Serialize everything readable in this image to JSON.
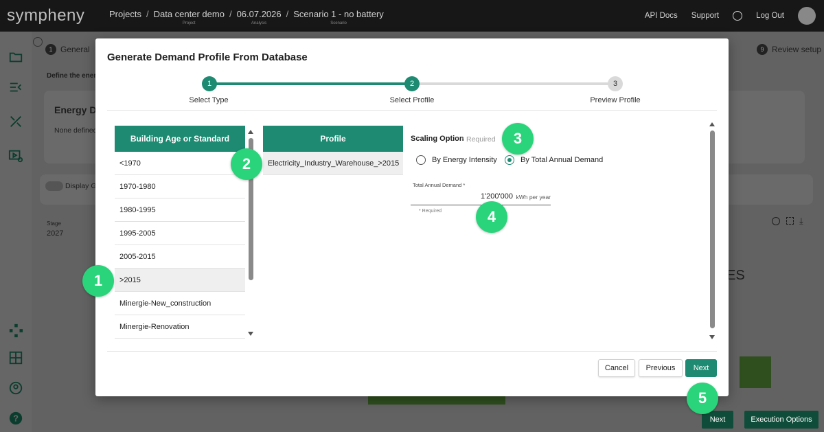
{
  "app": {
    "logo": "sympheny",
    "breadcrumbs": [
      {
        "label": "Projects",
        "sub": ""
      },
      {
        "label": "Data center demo",
        "sub": "Project"
      },
      {
        "label": "06.07.2026",
        "sub": "Analysis"
      },
      {
        "label": "Scenario 1 - no battery",
        "sub": "Scenario"
      }
    ],
    "top_links": {
      "api_docs": "API Docs",
      "support": "Support",
      "logout": "Log Out"
    }
  },
  "background": {
    "wizard_steps": {
      "first": "General",
      "first_num": "1",
      "last": "Review setup",
      "last_num": "9"
    },
    "define_text": "Define the ener",
    "energy_title": "Energy De",
    "none_defined": "None defined",
    "display_toggle": "Display G",
    "stage_label": "Stage",
    "stage_value": "2027",
    "partial_text": "ES",
    "next_button": "Next",
    "execution_button": "Execution Options"
  },
  "modal": {
    "title": "Generate Demand Profile From Database",
    "steps": [
      {
        "num": "1",
        "label": "Select Type"
      },
      {
        "num": "2",
        "label": "Select Profile"
      },
      {
        "num": "3",
        "label": "Preview Profile"
      }
    ],
    "building_header": "Building Age or Standard",
    "building_items": [
      "<1970",
      "1970-1980",
      "1980-1995",
      "1995-2005",
      "2005-2015",
      ">2015",
      "Minergie-New_construction",
      "Minergie-Renovation"
    ],
    "building_selected_index": 5,
    "profile_header": "Profile",
    "profile_items": [
      "Electricity_Industry_Warehouse_>2015"
    ],
    "scaling": {
      "label": "Scaling Option",
      "required": "* Required",
      "options": [
        "By Energy Intensity",
        "By Total Annual Demand"
      ],
      "selected": "By Total Annual Demand"
    },
    "demand_field": {
      "label": "Total Annual Demand *",
      "value": "1'200'000",
      "unit": "kWh per year",
      "help": "* Required"
    },
    "buttons": {
      "cancel": "Cancel",
      "previous": "Previous",
      "next": "Next"
    }
  },
  "badges": [
    "1",
    "2",
    "3",
    "4",
    "5"
  ],
  "colors": {
    "primary": "#1d8a71",
    "badge": "#2ad47b",
    "topbar": "#171717"
  }
}
